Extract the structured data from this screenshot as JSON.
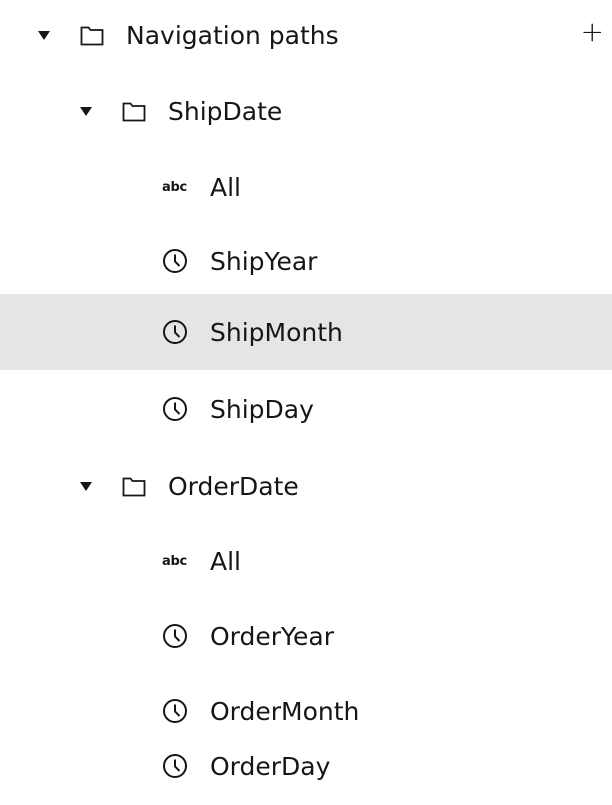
{
  "tree": {
    "root": {
      "label": "Navigation paths",
      "icon": "folder-icon",
      "add_icon": "+"
    },
    "ship_date": {
      "label": "ShipDate",
      "icon": "folder-icon",
      "children": [
        {
          "label": "All",
          "icon": "abc-icon",
          "icon_text": "abc"
        },
        {
          "label": "ShipYear",
          "icon": "clock-icon"
        },
        {
          "label": "ShipMonth",
          "icon": "clock-icon",
          "selected": true
        },
        {
          "label": "ShipDay",
          "icon": "clock-icon"
        }
      ]
    },
    "order_date": {
      "label": "OrderDate",
      "icon": "folder-icon",
      "children": [
        {
          "label": "All",
          "icon": "abc-icon",
          "icon_text": "abc"
        },
        {
          "label": "OrderYear",
          "icon": "clock-icon"
        },
        {
          "label": "OrderMonth",
          "icon": "clock-icon"
        },
        {
          "label": "OrderDay",
          "icon": "clock-icon"
        }
      ]
    }
  },
  "colors": {
    "text": "#161616",
    "selected_background": "#e5e5e5"
  }
}
